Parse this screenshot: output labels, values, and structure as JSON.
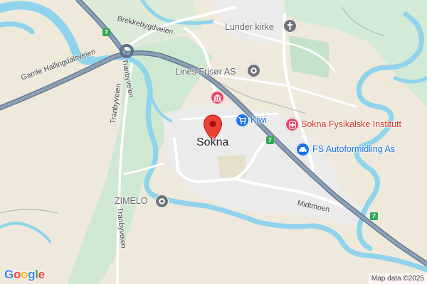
{
  "colors": {
    "water": "#8fd3ec",
    "forest": "#cde8d2",
    "land": "#efe9dc",
    "urban": "#ebebeb",
    "highway": "#7a8fa6",
    "highway_edge": "#5d7188",
    "road": "#ffffff",
    "poi_gray": "#6f7378",
    "poi_blue": "#1a73e8",
    "poi_red": "#d93025",
    "marker": "#ea4335",
    "shield": "#34a853"
  },
  "roads": {
    "brekkebygdveien": "Brekkebygdveien",
    "gamle_hallingdalsveien": "Gamle Hallingdalsveien",
    "tranbyveien": "Tranbyveien",
    "midtmoen": "Midtmoen"
  },
  "route_shield": "7",
  "pois": {
    "lunder_kirke": {
      "label": "Lunder kirke",
      "icon": "church-icon"
    },
    "lines_frisor": {
      "label": "Lines Frisør AS",
      "icon": "place-icon"
    },
    "kiwi": {
      "label": "Kiwi",
      "icon": "shopping-cart-icon"
    },
    "fysikalske": {
      "label": "Sokna Fysikalske Institutt",
      "icon": "hospital-icon"
    },
    "autoformidling": {
      "label": "FS Autoformidling As",
      "icon": "car-icon"
    },
    "zimelo": {
      "label": "ZIMELO",
      "icon": "place-icon"
    },
    "bank": {
      "label": "",
      "icon": "bank-icon"
    }
  },
  "place": {
    "label": "Sokna"
  },
  "logo": {
    "letters": [
      "G",
      "o",
      "o",
      "g",
      "l",
      "e"
    ],
    "colors": [
      "#4285F4",
      "#EA4335",
      "#FBBC05",
      "#4285F4",
      "#34A853",
      "#EA4335"
    ]
  },
  "attribution": "Map data ©2025"
}
